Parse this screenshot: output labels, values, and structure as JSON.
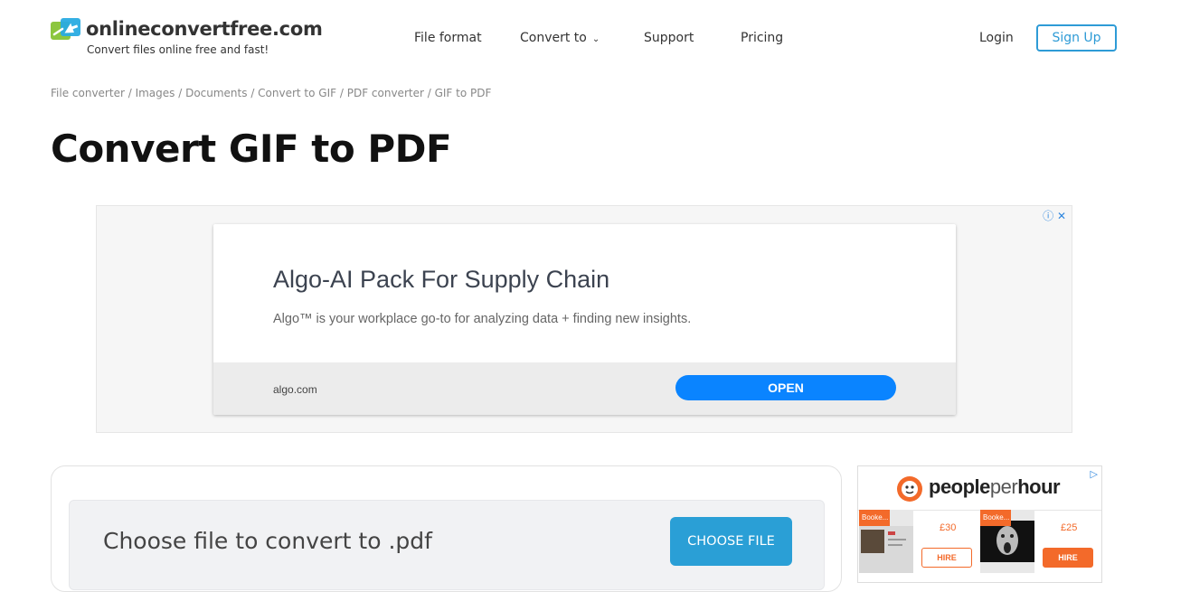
{
  "header": {
    "brand": "onlineconvertfree.com",
    "tagline": "Convert files online free and fast!",
    "nav": {
      "file_format": "File format",
      "convert_to": "Convert to",
      "support": "Support",
      "pricing": "Pricing"
    },
    "login": "Login",
    "signup": "Sign Up"
  },
  "breadcrumb": {
    "items": [
      "File converter",
      "Images",
      "Documents",
      "Convert to GIF",
      "PDF converter",
      "GIF to PDF"
    ],
    "separator": " / "
  },
  "page_title": "Convert GIF to PDF",
  "ad_top": {
    "headline": "Algo-AI Pack For Supply Chain",
    "description": "Algo™ is your workplace go-to for analyzing data + finding new insights.",
    "domain": "algo.com",
    "cta": "OPEN"
  },
  "converter": {
    "label": "Choose file to convert to .pdf",
    "button": "CHOOSE FILE"
  },
  "ad_side": {
    "brand_bold": "people",
    "brand_light": "per",
    "brand_bold2": "hour",
    "gigs": [
      {
        "tag": "Booke...",
        "price": "£30",
        "cta": "HIRE"
      },
      {
        "tag": "Booke...",
        "price": "£25",
        "cta": "HIRE"
      }
    ]
  },
  "colors": {
    "accent": "#2e9bd6",
    "choose_button": "#2a9fd6",
    "ad_open": "#0a84ff",
    "pph_orange": "#f36a2a",
    "logo_green": "#8cc63f",
    "logo_blue": "#29abe2"
  }
}
